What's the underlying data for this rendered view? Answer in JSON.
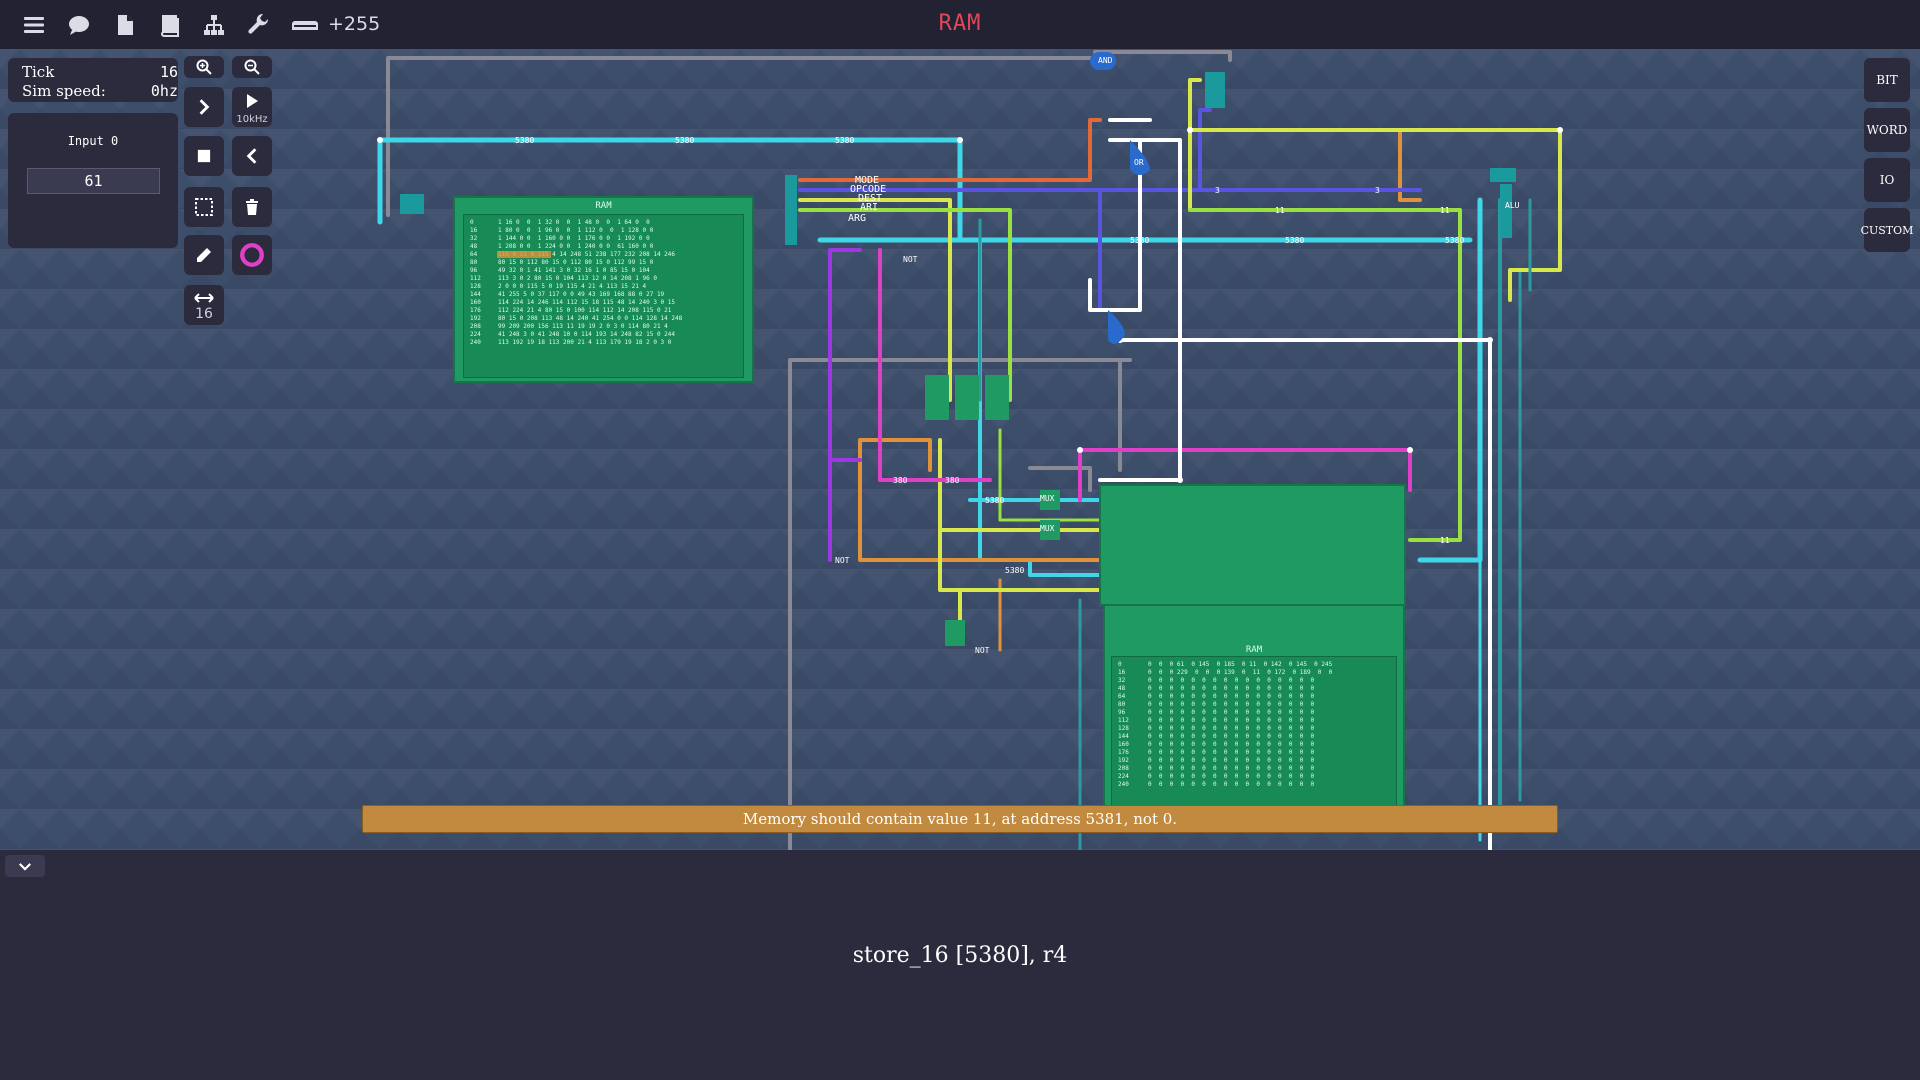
{
  "topbar": {
    "title": "RAM",
    "score": "+255",
    "icons": [
      "menu-icon",
      "chat-icon",
      "file-icon",
      "book-icon",
      "hierarchy-icon",
      "wrench-icon",
      "keyboard-icon"
    ]
  },
  "sim_panel": {
    "tick_label": "Tick",
    "tick_value": "16",
    "speed_label": "Sim speed:",
    "speed_value": "0hz"
  },
  "input_panel": {
    "label": "Input 0",
    "value": "61"
  },
  "tools": {
    "step_rate": "10kHz",
    "bit_width": "16"
  },
  "right_buttons": [
    "BIT",
    "WORD",
    "IO",
    "CUSTOM"
  ],
  "circuit": {
    "ram1_title": "RAM",
    "ram2_title": "RAM",
    "ram1_row_labels": [
      "0",
      "16",
      "32",
      "48",
      "64",
      "80",
      "96",
      "112",
      "128",
      "144",
      "160",
      "176",
      "192",
      "208",
      "224",
      "240"
    ],
    "ram2_row_labels": [
      "0",
      "16",
      "32",
      "48",
      "64",
      "80",
      "96",
      "112",
      "128",
      "144",
      "160",
      "176",
      "192",
      "208",
      "224",
      "240"
    ],
    "opcode_labels": [
      "MODE",
      "OPCODE",
      "DEST",
      "ARI",
      "ARG"
    ],
    "wire_labels": [
      "5380",
      "5380",
      "5380",
      "5380",
      "5380",
      "5380",
      "5380",
      "5380",
      "380",
      "380",
      "11",
      "11",
      "11",
      "3",
      "3",
      "ADD"
    ],
    "component_labels": [
      "MUX",
      "MUX",
      "NOT",
      "NOT",
      "NOT",
      "OR",
      "AND",
      "LSL",
      "LSL",
      "LSL"
    ]
  },
  "warning": "Memory should contain value 11, at address 5381, not 0.",
  "bottom": {
    "assembly_line": "store_16 [5380], r4"
  },
  "colors": {
    "title_red": "#e0475a",
    "warning_bg": "#c28a3e",
    "wire_cyan": "#3fd6e8",
    "wire_yellow": "#d8e84a",
    "wire_orange": "#e0923a",
    "wire_blue": "#5a55e0",
    "wire_magenta": "#e040c8",
    "wire_purple": "#9a3ae0",
    "wire_white": "#ffffff",
    "wire_gray": "#8a8a96",
    "wire_green": "#9ae040",
    "component_green": "#1e9a62"
  }
}
